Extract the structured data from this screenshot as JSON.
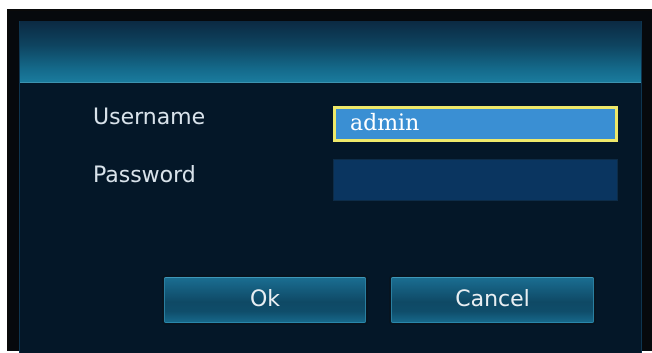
{
  "login": {
    "username_label": "Username",
    "password_label": "Password",
    "username_value": "admin",
    "password_value": ""
  },
  "buttons": {
    "ok_label": "Ok",
    "cancel_label": "Cancel"
  },
  "colors": {
    "panel_bg": "#041728",
    "titlebar_accent": "#1a7b9d",
    "selected_field_bg": "#3a8fd3",
    "selected_field_border": "#efe96a",
    "field_bg": "#0a3560"
  }
}
